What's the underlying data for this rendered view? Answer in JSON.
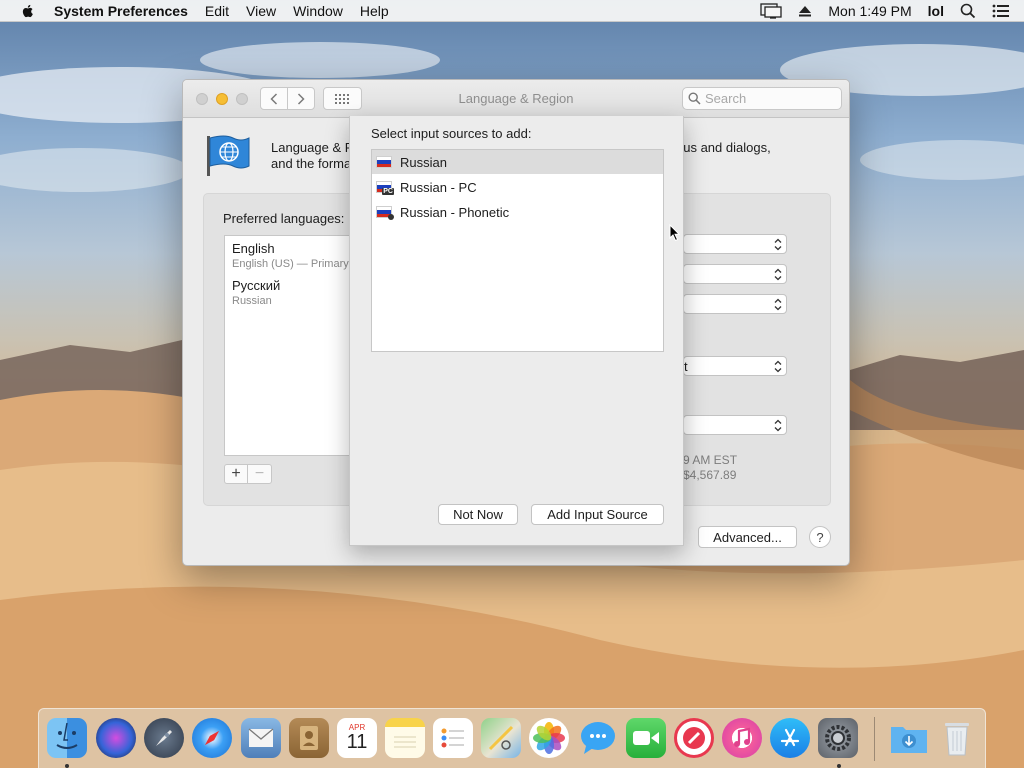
{
  "menubar": {
    "app_name": "System Preferences",
    "items": [
      "Edit",
      "View",
      "Window",
      "Help"
    ],
    "clock": "Mon 1:49 PM",
    "user": "lol"
  },
  "window": {
    "title": "Language & Region",
    "search_placeholder": "Search",
    "description_line1_left": "Language & R",
    "description_line1_right": "nus and dialogs,",
    "description_line2": "and the forma",
    "preferred_languages_label": "Preferred languages:",
    "languages": [
      {
        "name": "English",
        "detail": "English (US) — Primary"
      },
      {
        "name": "Русский",
        "detail": "Russian"
      }
    ],
    "add_label": "+",
    "remove_label": "−",
    "popup_values": [
      "",
      "",
      "",
      "t",
      ""
    ],
    "sample_time": "9 AM EST",
    "sample_number": "$4,567.89",
    "advanced_button": "Advanced...",
    "help_button": "?"
  },
  "sheet": {
    "title": "Select input sources to add:",
    "sources": [
      {
        "name": "Russian",
        "selected": true
      },
      {
        "name": "Russian - PC",
        "selected": false
      },
      {
        "name": "Russian - Phonetic",
        "selected": false
      }
    ],
    "pc_badge": "PC",
    "not_now_button": "Not Now",
    "add_button": "Add Input Source"
  },
  "dock": {
    "apps": [
      "finder-icon",
      "siri-icon",
      "launchpad-icon",
      "safari-icon",
      "mail-icon",
      "contacts-icon",
      "calendar-icon",
      "notes-icon",
      "reminders-icon",
      "maps-icon",
      "photos-icon",
      "messages-icon",
      "facetime-icon",
      "news-icon",
      "itunes-icon",
      "app-store-icon",
      "system-preferences-icon",
      "downloads-icon",
      "trash-icon"
    ],
    "calendar_month": "APR",
    "calendar_day": "11"
  },
  "colors": {
    "accent_traffic_yellow": "#f6be34",
    "selection_gray": "#dcdcdc",
    "flag_white": "#ffffff",
    "flag_blue": "#1c3fbd",
    "flag_red": "#d52b1e"
  }
}
